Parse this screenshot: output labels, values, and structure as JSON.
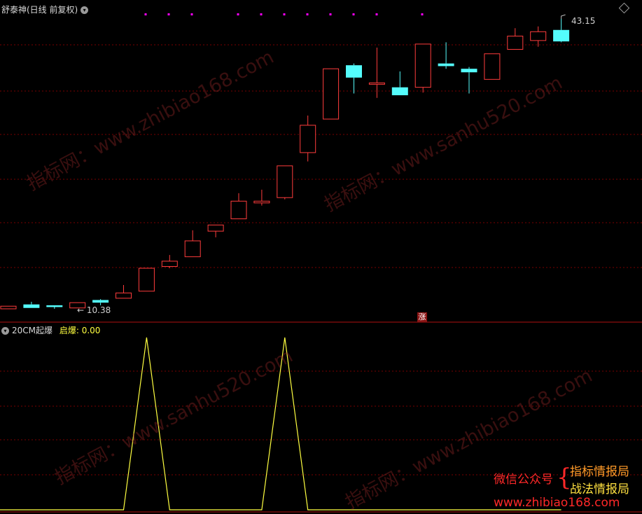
{
  "header": {
    "title": "舒泰神(日线 前复权)",
    "collapse_icon": "chevron-down-icon",
    "diamond_icon": "diamond-icon"
  },
  "main_chart": {
    "high_label": "43.15",
    "low_label": "← 10.38",
    "limit_badge": "涨",
    "candles": [
      {
        "o": 10.6,
        "c": 10.3,
        "h": 10.6,
        "l": 10.3,
        "dir": "up"
      },
      {
        "o": 10.8,
        "c": 10.4,
        "h": 11.1,
        "l": 10.4,
        "dir": "down"
      },
      {
        "o": 10.7,
        "c": 10.5,
        "h": 10.7,
        "l": 10.3,
        "dir": "down"
      },
      {
        "o": 10.4,
        "c": 11.0,
        "h": 11.0,
        "l": 10.4,
        "dir": "up"
      },
      {
        "o": 11.3,
        "c": 11.0,
        "h": 11.4,
        "l": 10.7,
        "dir": "down"
      },
      {
        "o": 11.5,
        "c": 12.1,
        "h": 13.0,
        "l": 11.5,
        "dir": "up"
      },
      {
        "o": 12.3,
        "c": 14.9,
        "h": 14.9,
        "l": 12.3,
        "dir": "up"
      },
      {
        "o": 15.1,
        "c": 15.7,
        "h": 16.4,
        "l": 14.9,
        "dir": "up"
      },
      {
        "o": 16.2,
        "c": 18.0,
        "h": 19.2,
        "l": 16.2,
        "dir": "up"
      },
      {
        "o": 19.1,
        "c": 19.8,
        "h": 19.8,
        "l": 18.4,
        "dir": "up"
      },
      {
        "o": 20.5,
        "c": 22.5,
        "h": 23.4,
        "l": 20.5,
        "dir": "up"
      },
      {
        "o": 22.5,
        "c": 22.3,
        "h": 23.8,
        "l": 22.0,
        "dir": "up"
      },
      {
        "o": 22.9,
        "c": 26.5,
        "h": 26.5,
        "l": 22.7,
        "dir": "up"
      },
      {
        "o": 28.0,
        "c": 31.1,
        "h": 32.2,
        "l": 27.0,
        "dir": "up"
      },
      {
        "o": 31.8,
        "c": 37.5,
        "h": 37.5,
        "l": 31.8,
        "dir": "up"
      },
      {
        "o": 37.9,
        "c": 36.5,
        "h": 38.1,
        "l": 34.7,
        "dir": "down"
      },
      {
        "o": 35.8,
        "c": 35.9,
        "h": 39.9,
        "l": 34.2,
        "dir": "up"
      },
      {
        "o": 35.4,
        "c": 34.5,
        "h": 37.2,
        "l": 34.5,
        "dir": "down"
      },
      {
        "o": 35.4,
        "c": 40.3,
        "h": 40.3,
        "l": 34.8,
        "dir": "up"
      },
      {
        "o": 38.1,
        "c": 37.8,
        "h": 40.5,
        "l": 37.5,
        "dir": "down"
      },
      {
        "o": 37.5,
        "c": 37.1,
        "h": 37.7,
        "l": 34.7,
        "dir": "down"
      },
      {
        "o": 36.3,
        "c": 39.2,
        "h": 39.2,
        "l": 36.3,
        "dir": "up"
      },
      {
        "o": 39.7,
        "c": 41.2,
        "h": 42.1,
        "l": 39.7,
        "dir": "up"
      },
      {
        "o": 40.7,
        "c": 41.7,
        "h": 42.3,
        "l": 40.0,
        "dir": "up"
      },
      {
        "o": 41.9,
        "c": 40.6,
        "h": 43.15,
        "l": 40.5,
        "dir": "down"
      }
    ]
  },
  "indicator": {
    "name": "20CM起爆",
    "param_label": "启爆: 0.00",
    "series": [
      0,
      0,
      0,
      0,
      0,
      0,
      1,
      0,
      0,
      0,
      0,
      0,
      1,
      0,
      0,
      0,
      0,
      0,
      0,
      0,
      0,
      0,
      0,
      0,
      0
    ]
  },
  "watermarks": {
    "site1": "指标网：www.zhibiao168.com",
    "site2": "指标网：www.sanhu520.com"
  },
  "promo": {
    "wechat": "微信公众号",
    "brace": "{",
    "line1": "指标情报局",
    "line2": "战法情报局",
    "url": "www.zhibiao168.com"
  },
  "colors": {
    "up": "#ff3c3c",
    "down": "#54fcfc",
    "grid": "#7a0000",
    "indicator": "#ffff40",
    "signal_dot": "#ff00ff",
    "promo_red": "#ff2828",
    "promo_orange": "#ff9a28",
    "promo_yellow": "#ffe040"
  }
}
